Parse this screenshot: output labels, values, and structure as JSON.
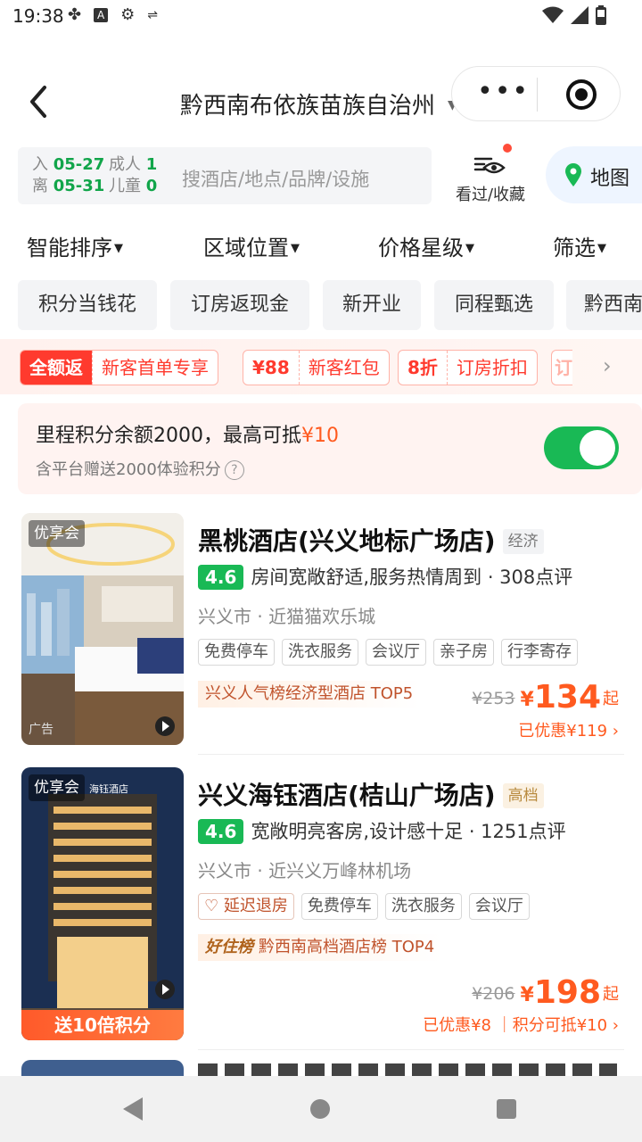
{
  "status_bar": {
    "time": "19:38",
    "icons": [
      "puzzle-icon",
      "a-box-icon",
      "gear-icon",
      "sync-icon"
    ],
    "right_icons": [
      "wifi-icon",
      "signal-icon",
      "battery-icon"
    ]
  },
  "header": {
    "back_icon": "chevron-left-icon",
    "city": "黔西南布依族苗族自治州",
    "capsule": {
      "more_icon": "more-dots-icon",
      "close_icon": "target-icon"
    }
  },
  "search": {
    "check_in_label": "入",
    "check_in": "05-27",
    "check_out_label": "离",
    "check_out": "05-31",
    "adults_label": "成人",
    "adults": "1",
    "children_label": "儿童",
    "children": "0",
    "placeholder": "搜酒店/地点/品牌/设施",
    "viewed_label": "看过/收藏",
    "map_label": "地图"
  },
  "sort_tabs": [
    "智能排序",
    "区域位置",
    "价格星级",
    "筛选"
  ],
  "quick_chips": [
    "积分当钱花",
    "订房返现金",
    "新开业",
    "同程甄选",
    "黔西南"
  ],
  "promos": [
    {
      "a": "全额返",
      "b": "新客首单专享"
    },
    {
      "a": "¥88",
      "b": "新客红包"
    },
    {
      "a": "8折",
      "b": "订房折扣"
    },
    {
      "a": "订",
      "b": ""
    }
  ],
  "points_card": {
    "line1_prefix": "里程积分余额2000，最高可抵",
    "line1_highlight": "¥10",
    "line2": "含平台赠送2000体验积分",
    "help": "?",
    "toggle_on": true,
    "toggle_color": "#19b955"
  },
  "hotels": [
    {
      "member_badge": "优享会",
      "ad_label": "广告",
      "name": "黑桃酒店(兴义地标广场店)",
      "grade": "经济",
      "score": "4.6",
      "comment": "房间宽敞舒适,服务热情周到",
      "reviews": "· 308点评",
      "location": "兴义市 · 近猫猫欢乐城",
      "facilities": [
        "免费停车",
        "洗衣服务",
        "会议厅",
        "亲子房",
        "行李寄存"
      ],
      "rank": "兴义人气榜经济型酒店 TOP5",
      "original_price": "¥253",
      "currency": "¥",
      "price": "134",
      "price_suffix": "起",
      "saved": "已优惠¥119 ›"
    },
    {
      "member_badge": "优享会",
      "hotel_logo": "海钰酒店",
      "bonus": "送10倍积分",
      "name": "兴义海钰酒店(桔山广场店)",
      "grade": "高档",
      "score": "4.6",
      "comment": "宽敞明亮客房,设计感十足",
      "reviews": "· 1251点评",
      "location": "兴义市 · 近兴义万峰林机场",
      "facilities": [
        "延迟退房",
        "免费停车",
        "洗衣服务",
        "会议厅"
      ],
      "rank_brand": "好住榜",
      "rank": "黔西南高档酒店榜 TOP4",
      "original_price": "¥206",
      "currency": "¥",
      "price": "198",
      "price_suffix": "起",
      "saved": "已优惠¥8 ｜积分可抵¥10 ›"
    }
  ],
  "colors": {
    "accent_green": "#19b955",
    "price_orange": "#ff5a1f",
    "promo_red": "#ff3a2e"
  }
}
